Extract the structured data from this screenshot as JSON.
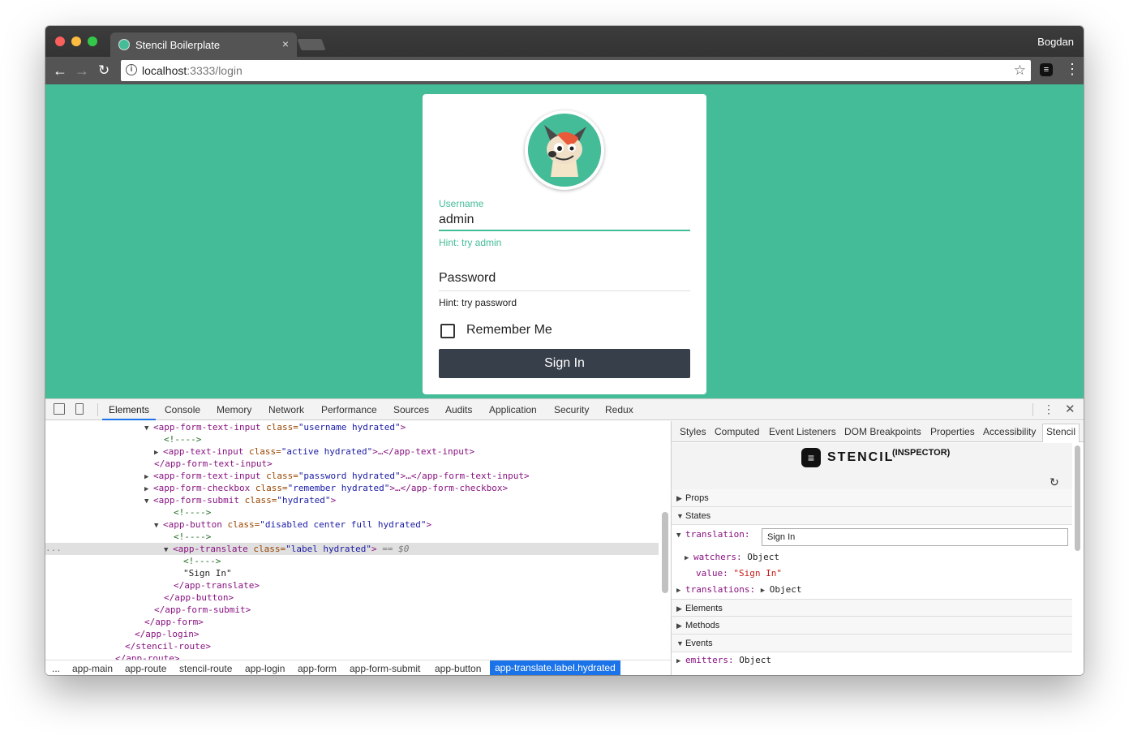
{
  "browser": {
    "tab_title": "Stencil Boilerplate",
    "tab_close": "×",
    "user_name": "Bogdan",
    "url_host": "localhost",
    "url_rest": ":3333/login",
    "nav_back": "←",
    "nav_forward": "→",
    "nav_reload": "↻",
    "info_glyph": "i",
    "star_glyph": "☆",
    "extension_glyph": "≡",
    "menu_glyph": "⋮"
  },
  "login": {
    "username_label": "Username",
    "username_value": "admin",
    "username_hint": "Hint: try admin",
    "password_label": "Password",
    "password_hint": "Hint: try password",
    "remember_label": "Remember Me",
    "remember_checked": false,
    "signin_label": "Sign In"
  },
  "devtools": {
    "tabs": [
      "Elements",
      "Console",
      "Memory",
      "Network",
      "Performance",
      "Sources",
      "Audits",
      "Application",
      "Security",
      "Redux"
    ],
    "active_tab": "Elements",
    "more_glyph": "⋮",
    "close_glyph": "✕",
    "code": [
      {
        "tri": "▼",
        "open": "<app-form-text-input",
        "attr": " class=",
        "val": "\"username hydrated\"",
        "close": ">"
      },
      {
        "comment": "<!---->"
      },
      {
        "tri": "▶",
        "open": "<app-text-input",
        "attr": " class=",
        "val": "\"active hydrated\"",
        "close": ">…</app-text-input>"
      },
      {
        "close_tag": "</app-form-text-input>"
      },
      {
        "tri": "▶",
        "open": "<app-form-text-input",
        "attr": " class=",
        "val": "\"password hydrated\"",
        "close": ">…</app-form-text-input>"
      },
      {
        "tri": "▶",
        "open": "<app-form-checkbox",
        "attr": " class=",
        "val": "\"remember hydrated\"",
        "close": ">…</app-form-checkbox>"
      },
      {
        "tri": "▼",
        "open": "<app-form-submit",
        "attr": " class=",
        "val": "\"hydrated\"",
        "close": ">"
      },
      {
        "comment": "<!---->"
      },
      {
        "tri": "▼",
        "open": "<app-button",
        "attr": " class=",
        "val": "\"disabled center full hydrated\"",
        "close": ">"
      },
      {
        "comment": "<!---->"
      },
      {
        "tri": "▼",
        "open": "<app-translate",
        "attr": " class=",
        "val": "\"label hydrated\"",
        "close": ">",
        "selected_suffix": " == $0"
      },
      {
        "comment": "<!---->"
      },
      {
        "text": "\"Sign In\""
      },
      {
        "close_tag": "</app-translate>"
      },
      {
        "close_tag": "</app-button>"
      },
      {
        "close_tag": "</app-form-submit>"
      },
      {
        "close_tag": "</app-form>"
      },
      {
        "close_tag": "</app-login>"
      },
      {
        "close_tag": "</stencil-route>"
      },
      {
        "close_tag": "</app-route>"
      }
    ],
    "selected_marker": "...",
    "breadcrumbs": [
      "...",
      "app-main",
      "app-route",
      "stencil-route",
      "app-login",
      "app-form",
      "app-form-submit",
      "app-button",
      "app-translate.label.hydrated"
    ],
    "side_tabs": [
      "Styles",
      "Computed",
      "Event Listeners",
      "DOM Breakpoints",
      "Properties",
      "Accessibility",
      "Stencil"
    ],
    "side_active_tab": "Stencil",
    "inspector": {
      "logo_text": "STENCIL",
      "logo_sup": "(INSPECTOR)",
      "logo_glyph": "≡",
      "refresh_glyph": "↻",
      "sections": {
        "props": "Props",
        "states": "States",
        "elements": "Elements",
        "methods": "Methods",
        "events": "Events"
      },
      "translation_key": "translation:",
      "translation_value": "Sign In",
      "watchers_key": "watchers:",
      "watchers_value": "Object",
      "value_key": "value:",
      "value_value": "\"Sign In\"",
      "translations_key": "translations:",
      "translations_value": "Object",
      "emitters_key": "emitters:",
      "emitters_value": "Object"
    }
  }
}
